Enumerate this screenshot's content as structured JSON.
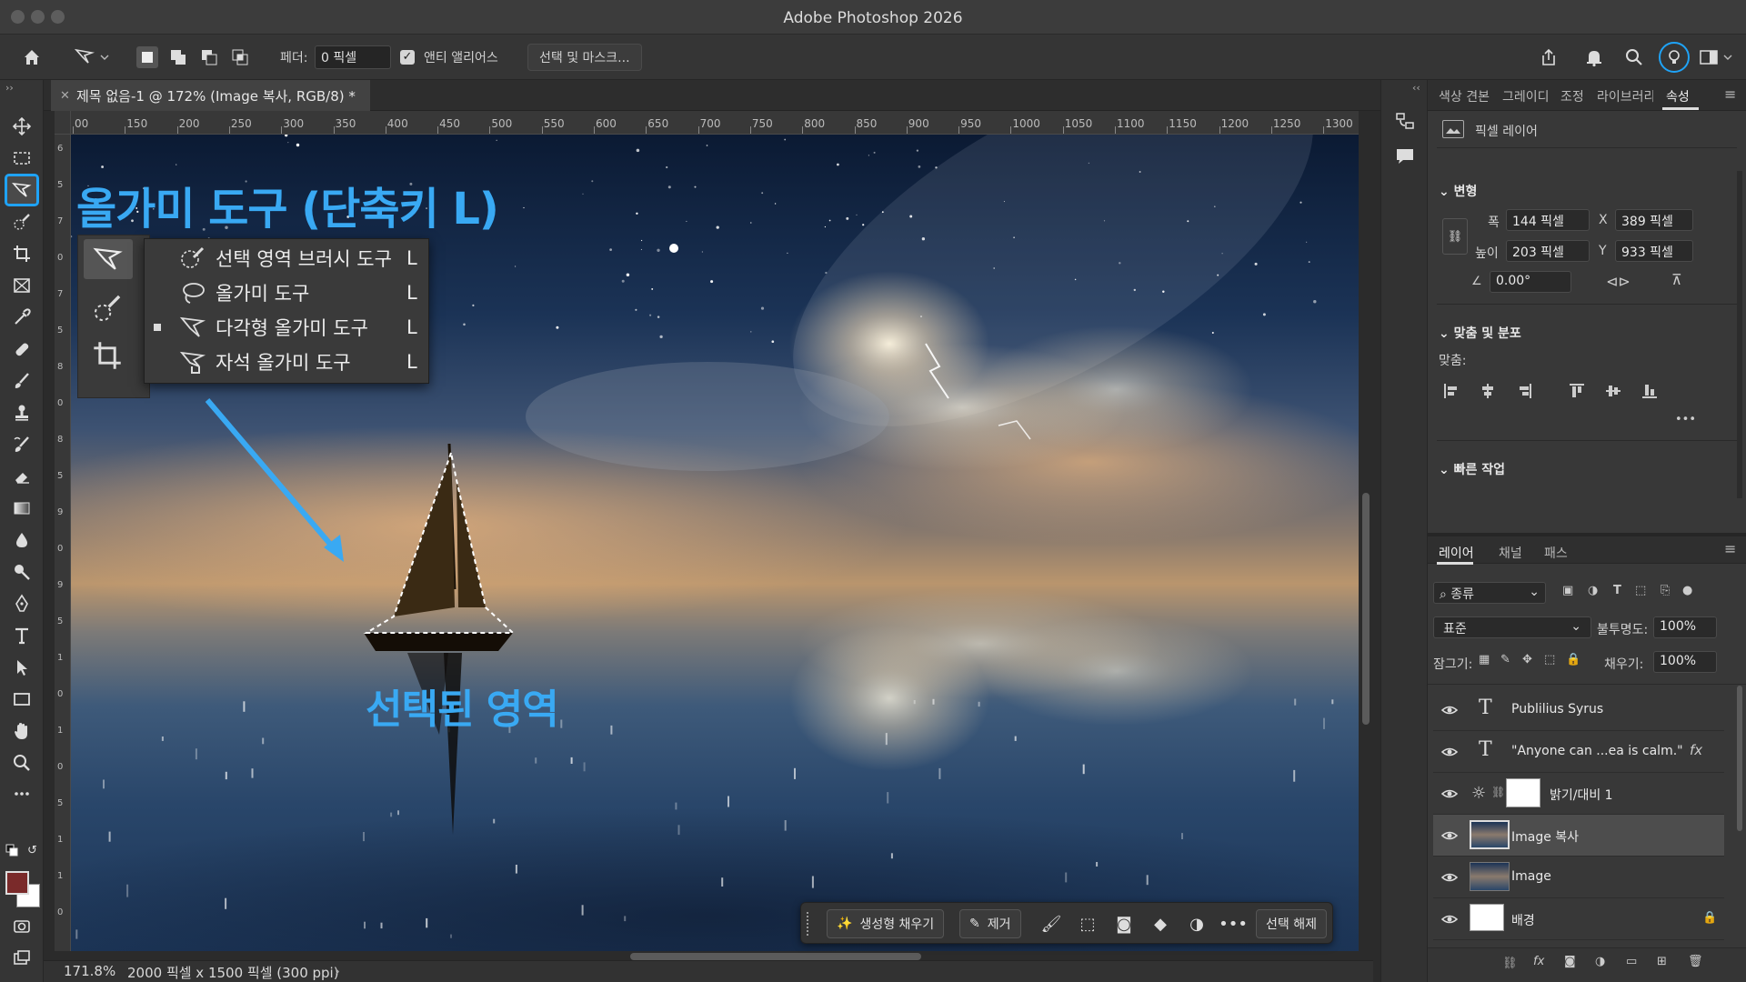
{
  "app": {
    "title": "Adobe Photoshop 2026"
  },
  "options_bar": {
    "feather_label": "페더:",
    "feather_value": "0 픽셀",
    "antialias_label": "앤티 앨리어스",
    "antialias_checked": true,
    "select_mask_label": "선택 및 마스크..."
  },
  "document": {
    "tab_title": "제목 없음-1 @ 172% (Image 복사, RGB/8) *",
    "ruler_h": [
      "00",
      "150",
      "200",
      "250",
      "300",
      "350",
      "400",
      "450",
      "500",
      "550",
      "600",
      "650",
      "700",
      "750",
      "800",
      "850",
      "900",
      "950",
      "1000",
      "1050",
      "1100",
      "1150",
      "1200",
      "1250",
      "1300"
    ],
    "ruler_v": [
      "6",
      "5",
      "7",
      "0",
      "7",
      "5",
      "8",
      "0",
      "8",
      "5",
      "9",
      "0",
      "9",
      "5",
      "1",
      "0",
      "1",
      "0",
      "5",
      "1",
      "1",
      "0"
    ],
    "zoom": "171.8%",
    "doc_info": "2000 픽셀 x 1500 픽셀 (300 ppi)"
  },
  "annotations": {
    "title": "올가미 도구 (단축키 L)",
    "selected_area": "선택된 영역",
    "color": "#39a9f3"
  },
  "tool_flyout": {
    "items": [
      {
        "label": "선택 영역 브러시 도구",
        "key": "L",
        "icon": "selection-brush-icon",
        "active": false
      },
      {
        "label": "올가미 도구",
        "key": "L",
        "icon": "lasso-icon",
        "active": false
      },
      {
        "label": "다각형 올가미 도구",
        "key": "L",
        "icon": "polygonal-lasso-icon",
        "active": true
      },
      {
        "label": "자석 올가미 도구",
        "key": "L",
        "icon": "magnetic-lasso-icon",
        "active": false
      }
    ]
  },
  "taskbar": {
    "generative_fill": "생성형 채우기",
    "remove": "제거",
    "deselect": "선택 해제"
  },
  "properties_panel": {
    "tabs": [
      "색상 견본",
      "그레이디",
      "조정",
      "라이브러리",
      "속성"
    ],
    "active_tab": "속성",
    "layer_type": "픽셀 레이어",
    "transform_header": "변형",
    "width_label": "폭",
    "width_value": "144 픽셀",
    "height_label": "높이",
    "height_value": "203 픽셀",
    "x_label": "X",
    "x_value": "389 픽셀",
    "y_label": "Y",
    "y_value": "933 픽셀",
    "angle_value": "0.00°",
    "align_header": "맞춤 및 분포",
    "align_label": "맞춤:",
    "quick_actions_header": "빠른 작업"
  },
  "layers_panel": {
    "tabs": [
      "레이어",
      "채널",
      "패스"
    ],
    "active_tab": "레이어",
    "filter_label": "종류",
    "blend_mode": "표준",
    "opacity_label": "불투명도:",
    "opacity_value": "100%",
    "lock_label": "잠그기:",
    "fill_label": "채우기:",
    "fill_value": "100%",
    "layers": [
      {
        "name": "Publilius Syrus",
        "type": "text",
        "selected": false
      },
      {
        "name": "\"Anyone can ...ea is calm.\"",
        "type": "text",
        "selected": false,
        "fx": "fx"
      },
      {
        "name": "밝기/대비 1",
        "type": "adjustment",
        "selected": false
      },
      {
        "name": "Image 복사",
        "type": "image",
        "selected": true
      },
      {
        "name": "Image",
        "type": "image",
        "selected": false
      },
      {
        "name": "배경",
        "type": "background",
        "selected": false,
        "locked": true
      }
    ]
  },
  "colors": {
    "accent": "#1fa3f7",
    "foreground_swatch": "#7a2a2a",
    "background_swatch": "#ffffff"
  }
}
